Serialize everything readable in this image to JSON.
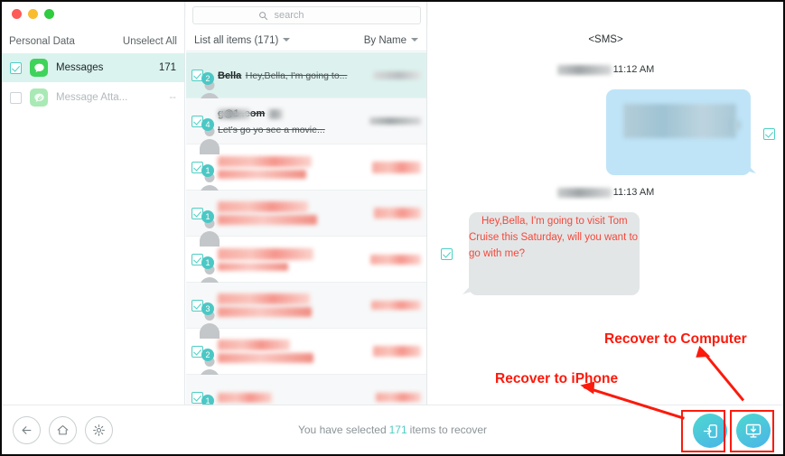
{
  "window": {
    "traffic_lights": [
      "close",
      "minimize",
      "maximize"
    ]
  },
  "sidebar": {
    "header_title": "Personal Data",
    "unselect_all": "Unselect All",
    "items": [
      {
        "label": "Messages",
        "count": "171",
        "checked": true,
        "icon": "message-bubble-icon"
      },
      {
        "label": "Message Atta...",
        "count": "--",
        "checked": false,
        "icon": "paperclip-bubble-icon"
      }
    ]
  },
  "list_panel": {
    "search_placeholder": "search",
    "search_value": "",
    "filter_label": "List all items (171)",
    "sort_label": "By Name",
    "rows": [
      {
        "badge": "2",
        "title": "Bella",
        "subtitle": "Hey,Bella, I'm going to...",
        "redacted": false,
        "selected": true
      },
      {
        "badge": "4",
        "title": "g@1 .com",
        "subtitle": "Let's go yo see a movie...",
        "redacted": false,
        "selected": false
      },
      {
        "badge": "1",
        "title": "",
        "subtitle": "",
        "redacted": true,
        "selected": false
      },
      {
        "badge": "1",
        "title": "",
        "subtitle": "",
        "redacted": true,
        "selected": false
      },
      {
        "badge": "1",
        "title": "",
        "subtitle": "",
        "redacted": true,
        "selected": false
      },
      {
        "badge": "3",
        "title": "",
        "subtitle": "",
        "redacted": true,
        "selected": false
      },
      {
        "badge": "2",
        "title": "",
        "subtitle": "",
        "redacted": true,
        "selected": false
      },
      {
        "badge": "1",
        "title": "",
        "subtitle": "",
        "redacted": true,
        "selected": false
      }
    ]
  },
  "conversation": {
    "header": "<SMS>",
    "messages": [
      {
        "timestamp": "11:12 AM",
        "direction": "outgoing",
        "text": "",
        "redacted": true,
        "checked": true
      },
      {
        "timestamp": "11:13 AM",
        "direction": "incoming",
        "text": "Hey,Bella, I'm going to visit Tom Cruise this Saturday, will you want to go with me?",
        "redacted": false,
        "checked": true
      }
    ]
  },
  "bottom_bar": {
    "nav_buttons": [
      {
        "name": "back-button",
        "icon": "arrow-left-icon"
      },
      {
        "name": "home-button",
        "icon": "home-icon"
      },
      {
        "name": "settings-button",
        "icon": "gear-icon"
      }
    ],
    "status_prefix": "You have selected",
    "status_count": "171",
    "status_suffix": "items to recover",
    "recover_to_iphone_label": "Recover to iPhone",
    "recover_to_computer_label": "Recover to Computer"
  },
  "annotations": {
    "recover_to_computer": "Recover to Computer",
    "recover_to_iphone": "Recover to iPhone"
  },
  "colors": {
    "accent_teal": "#4ecdc4",
    "annotation_red": "#fb1a0c",
    "selected_row": "#ddf2ee",
    "outgoing_bubble": "#bfe4f7",
    "incoming_bubble": "#e3e6e7",
    "message_text_red": "#f4483a"
  }
}
